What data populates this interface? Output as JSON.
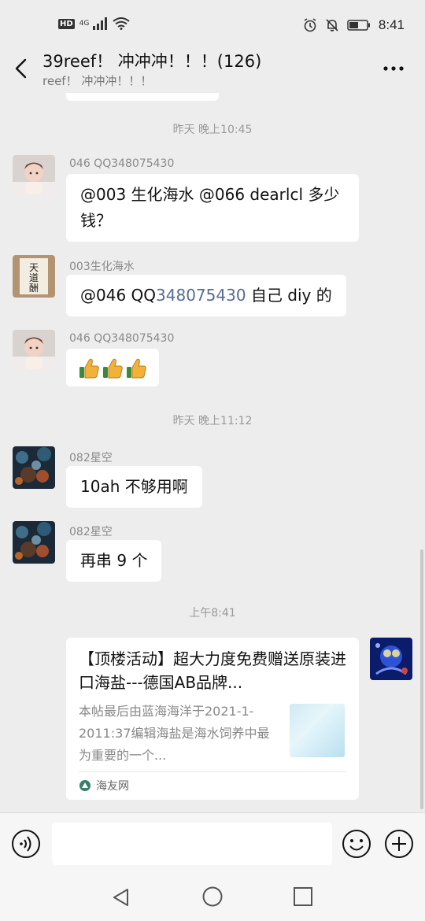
{
  "status_bar": {
    "hd": "HD",
    "network": "4G",
    "time": "8:41"
  },
  "header": {
    "title": "39reef！ 冲冲冲！！！(126)",
    "subtitle": "reef！ 冲冲冲！！！"
  },
  "messages": [
    {
      "timestamp": "昨天 晚上10:45"
    },
    {
      "sender": "046 QQ348075430",
      "text": "@003 生化海水  @066 dearlcl  多少钱？"
    },
    {
      "sender": "003生化海水",
      "text_prefix": "@046 QQ",
      "text_link": "348075430",
      "text_suffix": "  自己 diy 的"
    },
    {
      "sender": "046 QQ348075430",
      "emoji": "👍👍👍"
    },
    {
      "timestamp": "昨天 晚上11:12"
    },
    {
      "sender": "082星空",
      "text": "10ah 不够用啊"
    },
    {
      "sender": "082星空",
      "text": "再串 9 个"
    },
    {
      "timestamp": "上午8:41"
    }
  ],
  "link_card": {
    "title": "【顶楼活动】超大力度免费赠送原装进口海盐---德国AB品牌...",
    "description": "本帖最后由蓝海海洋于2021-1-2011:37编辑海盐是海水饲养中最为重要的一个...",
    "source": "海友网"
  },
  "input": {
    "value": "",
    "placeholder": ""
  },
  "colors": {
    "background": "#ededed",
    "bubble": "#ffffff",
    "mention_link": "#576b95",
    "timestamp": "#999999"
  }
}
